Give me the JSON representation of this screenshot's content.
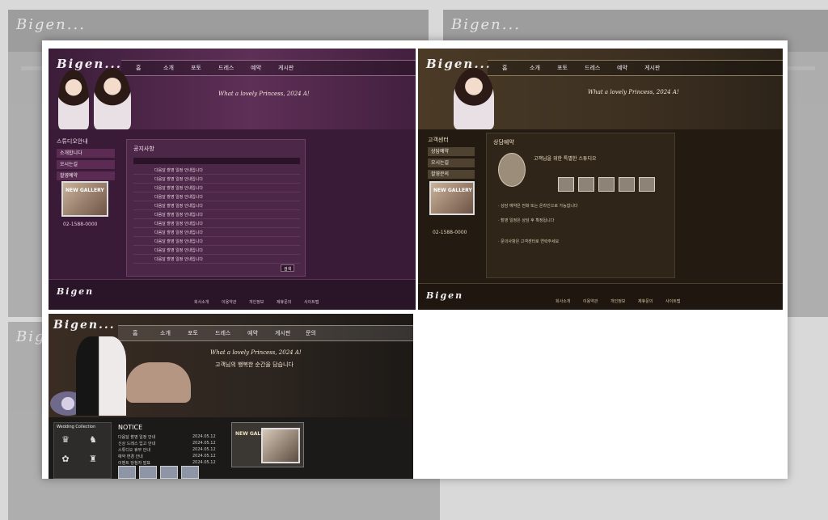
{
  "purple": {
    "logo": "Bigen...",
    "tagline": "What a lovely Princess, 2024 A!",
    "tagline2": "&nbsp;",
    "nav": [
      "홈",
      "소개",
      "포토",
      "드레스",
      "예약",
      "게시판"
    ],
    "side_title": "스튜디오안내",
    "side_items": [
      "소개합니다",
      "오시는길",
      "촬영예약"
    ],
    "thumb_label": "NEW GALLERY",
    "phone": "02-1588-0000",
    "panel_title": "공지사항",
    "rows": 11,
    "row_text": "다음달 촬영 일정 안내입니다",
    "search_btn": "검색",
    "footer_logo": "Bigen",
    "footer_links": [
      "회사소개",
      "이용약관",
      "개인정보",
      "제휴문의",
      "사이트맵"
    ]
  },
  "brown": {
    "logo": "Bigen...",
    "tagline": "What a lovely Princess, 2024 A!",
    "nav": [
      "홈",
      "소개",
      "포토",
      "드레스",
      "예약",
      "게시판"
    ],
    "side_title": "고객센터",
    "side_items": [
      "상담예약",
      "오시는길",
      "촬영문의"
    ],
    "thumb_label": "NEW GALLERY",
    "phone": "02-1588-0000",
    "panel_title": "상담예약",
    "intro": "고객님을 위한 특별한 스튜디오",
    "lines": [
      "· 상담 예약은 전화 또는 온라인으로 가능합니다",
      "· 촬영 일정은 상담 후 확정됩니다",
      "· 문의사항은 고객센터로 연락주세요"
    ],
    "footer_logo": "Bigen",
    "footer_links": [
      "회사소개",
      "이용약관",
      "개인정보",
      "제휴문의",
      "사이트맵"
    ]
  },
  "dark": {
    "logo": "Bigen...",
    "tagline": "What a lovely Princess, 2024 A!",
    "tagline2": "고객님의 행복한 순간을 담습니다",
    "nav": [
      "홈",
      "소개",
      "포토",
      "드레스",
      "예약",
      "게시판",
      "문의"
    ],
    "left_title": "Wedding Collection",
    "list_title": "NOTICE",
    "list_rows": [
      "다음달 촬영 일정 안내",
      "신상 드레스 입고 안내",
      "스튜디오 휴무 안내",
      "예약 변경 안내",
      "이벤트 당첨자 발표"
    ],
    "list_date": "2024.05.12",
    "thumb_label": "NEW GALLERY"
  },
  "ghost_logo": "Bigen..."
}
